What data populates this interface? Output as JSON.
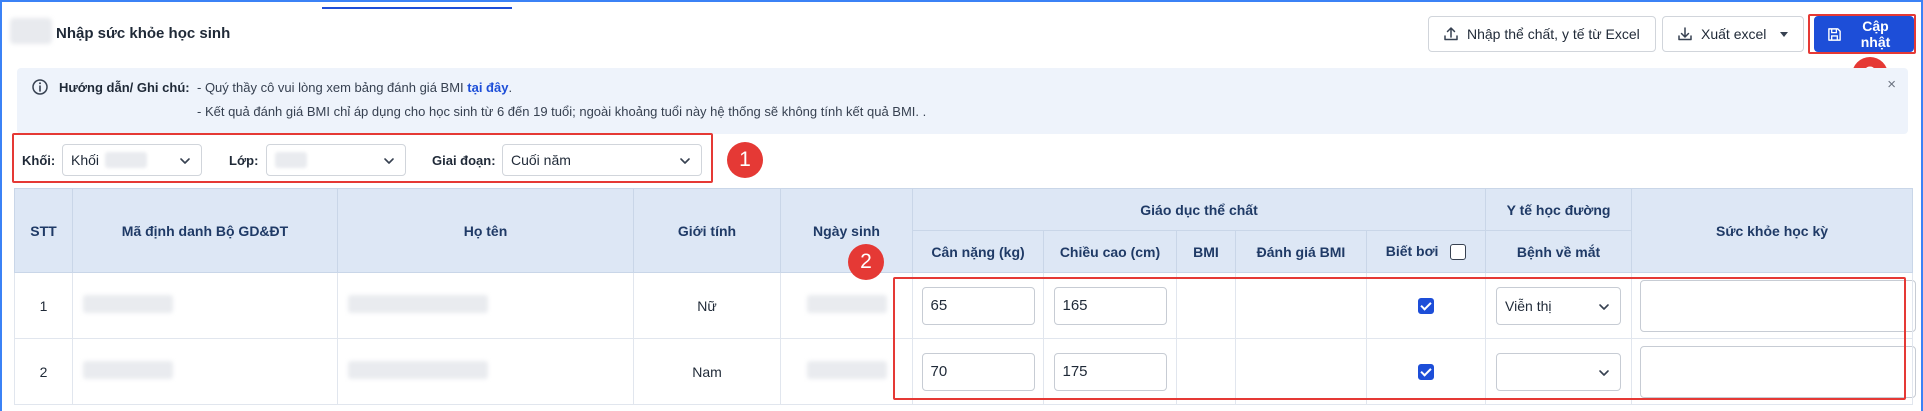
{
  "header": {
    "title": "Nhập sức khỏe học sinh",
    "import_label": "Nhập thể chất, y tế từ Excel",
    "export_label": "Xuất excel",
    "update_label": "Cập nhật"
  },
  "note": {
    "label": "Hướng dẫn/ Ghi chú:",
    "line1_prefix": "- Quý thầy cô vui lòng xem bảng đánh giá BMI ",
    "line1_link": "tại đây",
    "line1_suffix": ".",
    "line2": "- Kết quả đánh giá BMI chỉ áp dụng cho học sinh từ 6 đến 19 tuổi; ngoài khoảng tuổi này hệ thống sẽ không tính kết quả BMI. .",
    "close": "×"
  },
  "filters": {
    "khoi_label": "Khối:",
    "khoi_value": "Khối",
    "lop_label": "Lớp:",
    "lop_value": "",
    "giaidoan_label": "Giai đoạn:",
    "giaidoan_value": "Cuối năm"
  },
  "annotations": {
    "badge1": "1",
    "badge2": "2",
    "badge3": "3"
  },
  "table": {
    "headers": {
      "stt": "STT",
      "ma_dinh_danh": "Mã định danh Bộ GD&ĐT",
      "ho_ten": "Họ tên",
      "gioi_tinh": "Giới tính",
      "ngay_sinh": "Ngày sinh",
      "giao_duc_the_chat": "Giáo dục thể chất",
      "can_nang": "Cân nặng (kg)",
      "chieu_cao": "Chiều cao (cm)",
      "bmi": "BMI",
      "danh_gia_bmi": "Đánh giá BMI",
      "biet_boi": "Biết bơi",
      "y_te_hoc_duong": "Y tế học đường",
      "benh_ve_mat": "Bệnh về mắt",
      "suc_khoe_hoc_ky": "Sức khỏe học kỳ"
    },
    "rows": [
      {
        "stt": "1",
        "gioi_tinh": "Nữ",
        "can_nang": "65",
        "chieu_cao": "165",
        "biet_boi": true,
        "benh_ve_mat": "Viễn thị"
      },
      {
        "stt": "2",
        "gioi_tinh": "Nam",
        "can_nang": "70",
        "chieu_cao": "175",
        "biet_boi": true,
        "benh_ve_mat": ""
      }
    ]
  },
  "colors": {
    "primary": "#1d4ed8",
    "highlight": "#e53935",
    "header_bg": "#dde7f5",
    "note_bg": "#eef3fb"
  }
}
